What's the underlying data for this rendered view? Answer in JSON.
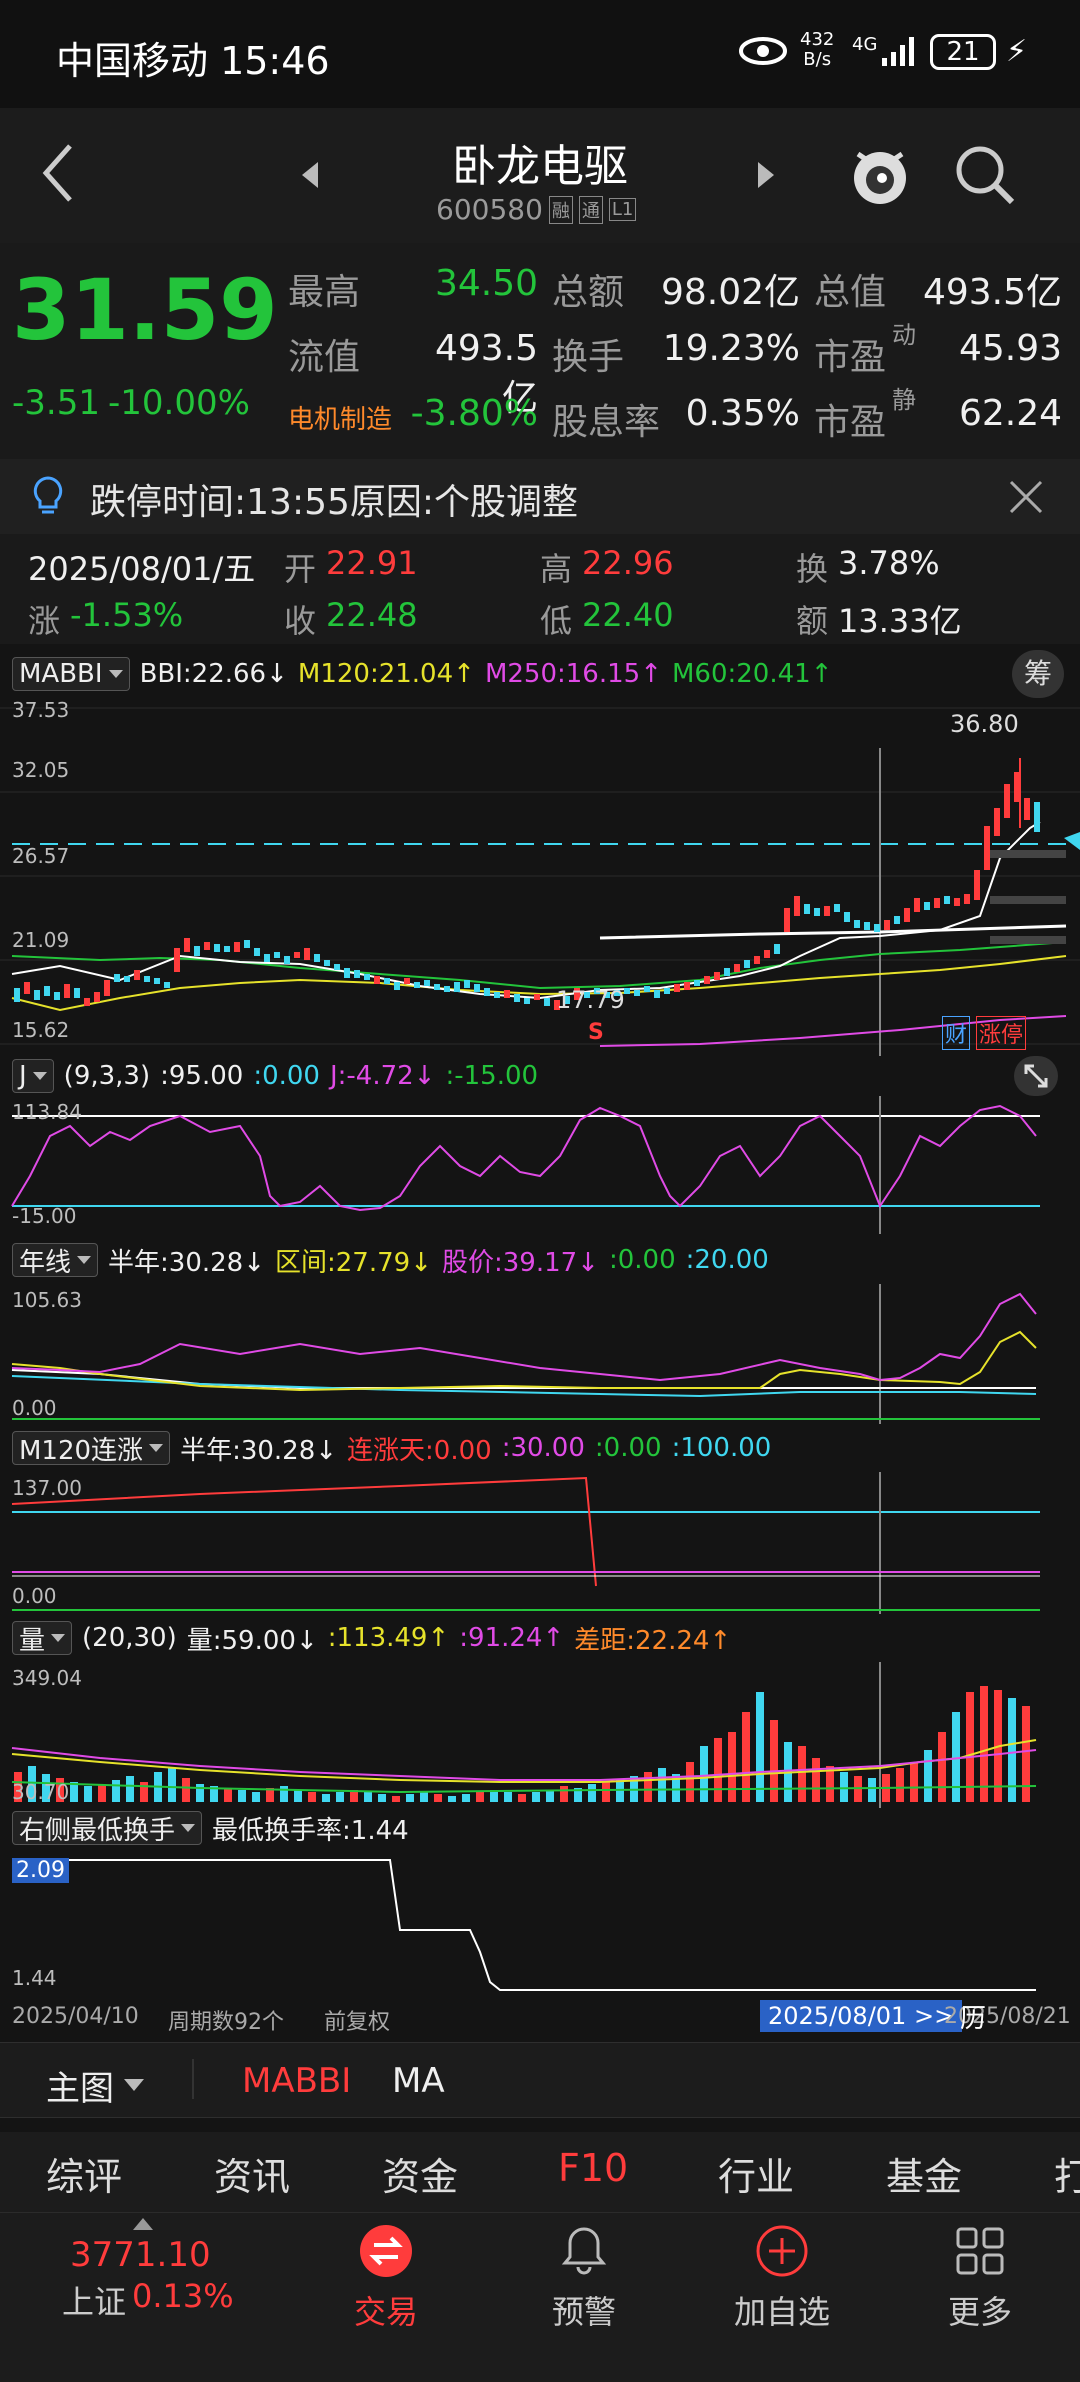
{
  "status": {
    "carrier_time": "中国移动 15:46",
    "net_speed_top": "432",
    "net_speed_bottom": "B/s",
    "net_type": "4G",
    "battery": "21"
  },
  "header": {
    "stock_name": "卧龙电驱",
    "stock_code": "600580",
    "tag1": "融",
    "tag2": "通",
    "tag3": "L1"
  },
  "quote": {
    "price": "31.59",
    "change": "-3.51",
    "change_pct": "-10.00%",
    "row1": [
      {
        "label": "最高",
        "value": "34.50"
      },
      {
        "label": "总额",
        "value": "98.02亿"
      },
      {
        "label": "总值",
        "value": "493.5亿"
      }
    ],
    "row2": [
      {
        "label": "流值",
        "value": "493.5亿"
      },
      {
        "label": "换手",
        "value": "19.23%"
      },
      {
        "label": "市盈",
        "sup": "动",
        "value": "45.93"
      }
    ],
    "row3": [
      {
        "label": "电机制造",
        "value": "-3.80%"
      },
      {
        "label": "股息率",
        "value": "0.35%"
      },
      {
        "label": "市盈",
        "sup": "静",
        "value": "62.24"
      }
    ]
  },
  "notice": {
    "text": "跌停时间:13:55原因:个股调整"
  },
  "day": {
    "date": "2025/08/01/五",
    "open_l": "开",
    "open_v": "22.91",
    "high_l": "高",
    "high_v": "22.96",
    "turn_l": "换",
    "turn_v": "3.78%",
    "chg_l": "涨",
    "chg_v": "-1.53%",
    "close_l": "收",
    "close_v": "22.48",
    "low_l": "低",
    "low_v": "22.40",
    "amt_l": "额",
    "amt_v": "13.33亿"
  },
  "main_chart": {
    "indicator": "MABBI",
    "bbi": "BBI:22.66↓",
    "m120": "M120:21.04↑",
    "m250": "M250:16.15↑",
    "m60": "M60:20.41↑",
    "chip_btn": "筹",
    "y_labels": [
      "37.53",
      "32.05",
      "26.57",
      "21.09",
      "15.62"
    ],
    "high_mark": "36.80",
    "low_mark": "17.79",
    "s_mark": "S",
    "tag_cai": "财",
    "tag_zd": "涨停"
  },
  "kdj": {
    "indicator": "J",
    "params": "(9,3,3)",
    "v1": ":95.00",
    "v2": ":0.00",
    "v3": "J:-4.72↓",
    "v4": ":-15.00",
    "y_top": "113.84",
    "y_bot": "-15.00"
  },
  "year_line": {
    "indicator": "年线",
    "half": "半年:30.28↓",
    "range": "区间:27.79↓",
    "price": "股价:39.17↓",
    "v1": ":0.00",
    "v2": ":20.00",
    "y_top": "105.63",
    "y_bot": "0.00"
  },
  "m120": {
    "indicator": "M120连涨",
    "half": "半年:30.28↓",
    "days": "连涨天:0.00",
    "v1": ":30.00",
    "v2": ":0.00",
    "v3": ":100.00",
    "y_top": "137.00",
    "y_bot": "0.00"
  },
  "volume": {
    "indicator": "量",
    "params": "(20,30)",
    "vol": "量:59.00↓",
    "ma1": ":113.49↑",
    "ma2": ":91.24↑",
    "diff": "差距:22.24↑",
    "y_top": "349.04",
    "y_bot": "30.70"
  },
  "turnover": {
    "indicator": "右侧最低换手",
    "label": "最低换手率:1.44",
    "y_top": "2.09",
    "y_bot": "1.44"
  },
  "footer_axis": {
    "start": "2025/04/10",
    "period": "周期数92个",
    "adjust": "前复权",
    "cursor_date": "2025/08/01 >>",
    "end": "2025/08/21",
    "end_tag": "历"
  },
  "chart_tabs": {
    "main": "主图",
    "t1": "MABBI",
    "t2": "MA"
  },
  "f10_tabs": [
    "综评",
    "资讯",
    "资金",
    "F10",
    "行业",
    "基金",
    "打"
  ],
  "bottom_nav": {
    "index_value": "3771.10",
    "index_name": "上证",
    "index_pct": "0.13%",
    "trade": "交易",
    "alert": "预警",
    "add": "加自选",
    "more": "更多"
  }
}
